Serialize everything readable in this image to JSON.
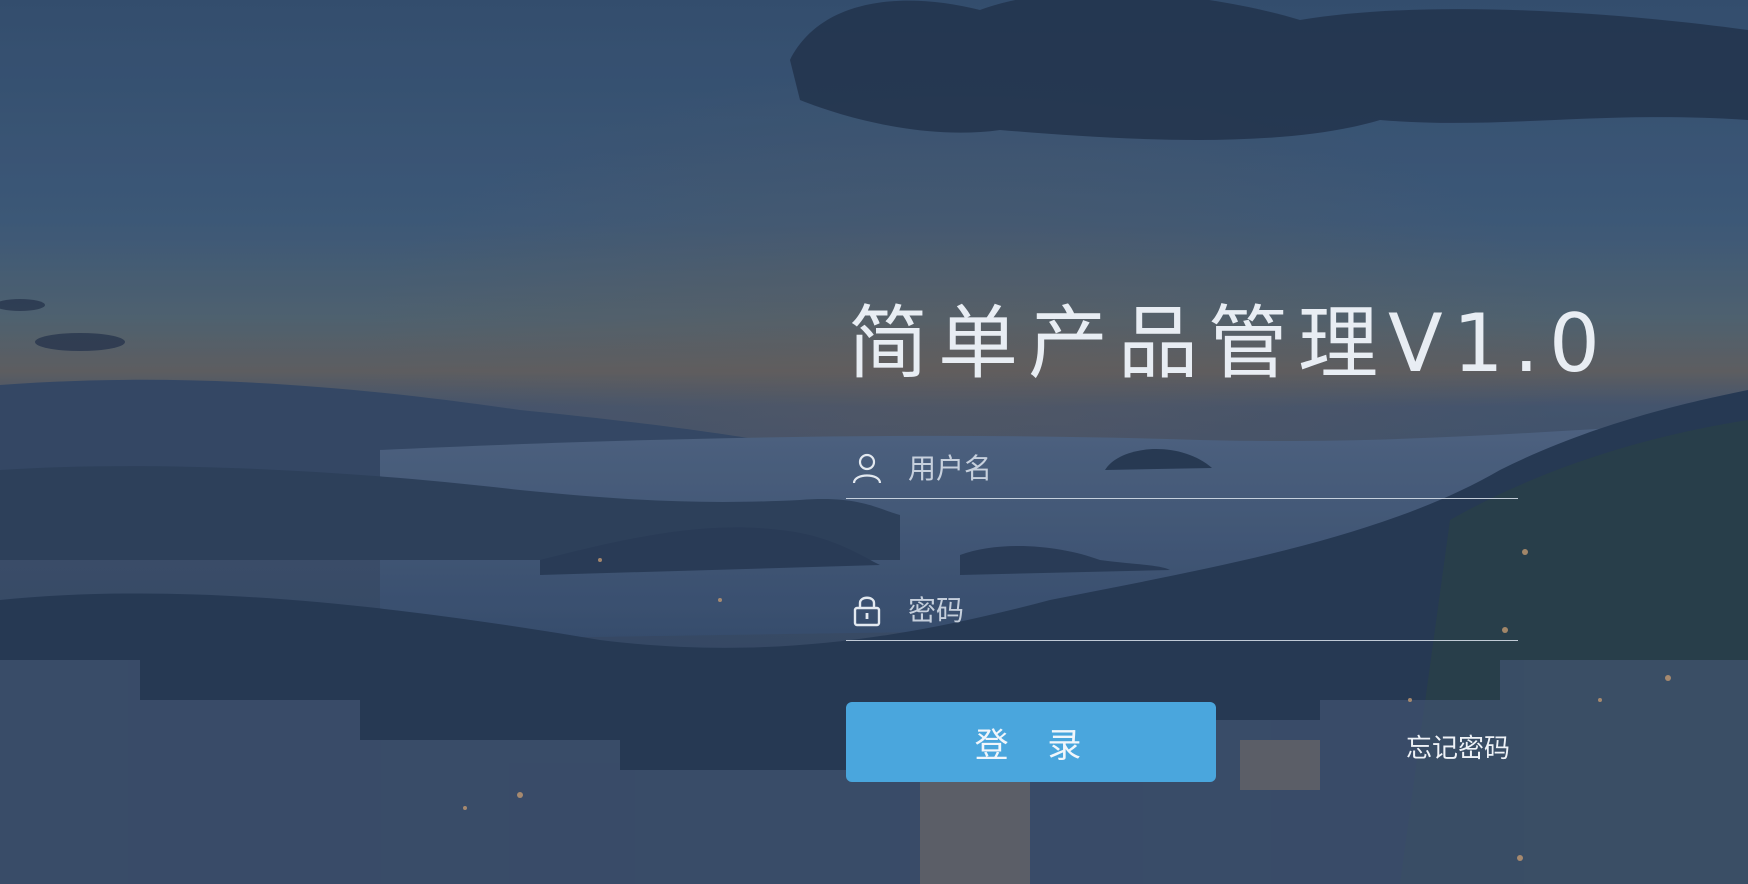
{
  "app": {
    "title": "简单产品管理V1.0"
  },
  "login": {
    "username_placeholder": "用户名",
    "password_placeholder": "密码",
    "submit_label": "登 录",
    "forgot_label": "忘记密码"
  },
  "icons": {
    "username": "user-icon",
    "password": "lock-icon"
  },
  "colors": {
    "accent": "#4aa6dd",
    "text": "#e8edf3"
  }
}
